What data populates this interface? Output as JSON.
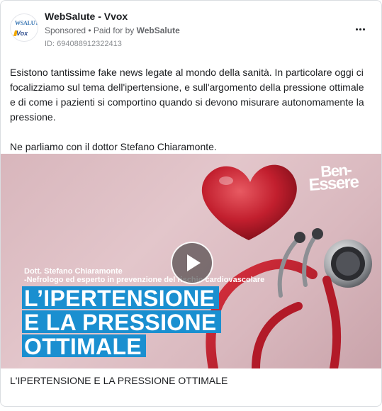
{
  "post": {
    "page_name": "WebSalute - Vvox",
    "sponsored_label": "Sponsored",
    "separator": " • ",
    "paid_for_prefix": "Paid for by ",
    "paid_for_name": "WebSalute",
    "ad_id": "ID: 694088912322413",
    "avatar_text_top": "WSALUTE",
    "avatar_text_bottom": "Vox",
    "body_paragraphs": [
      "Esistono tantissime fake news legate al mondo della sanità. In particolare oggi ci focalizziamo sul tema dell'ipertensione, e sull'argomento della pressione ottimale e di come i pazienti si comportino quando si devono misurare autonomamente la pressione.",
      "Ne parliamo con il dottor Stefano Chiaramonte."
    ]
  },
  "media": {
    "logo_line1": "Ben-",
    "logo_line2": "Essere",
    "doctor_name": "Dott. Stefano Chiaramonte",
    "doctor_role": "-Nefrologo ed esperto in prevenzione del rischio cardiovascolare",
    "headline_lines": [
      "L’IPERTENSIONE",
      "E LA PRESSIONE",
      "OTTIMALE"
    ],
    "play_icon": "play-icon",
    "accent_color": "#1a8fd0"
  },
  "caption": "L'IPERTENSIONE E LA PRESSIONE OTTIMALE",
  "icons": {
    "more": "more-options-icon"
  }
}
